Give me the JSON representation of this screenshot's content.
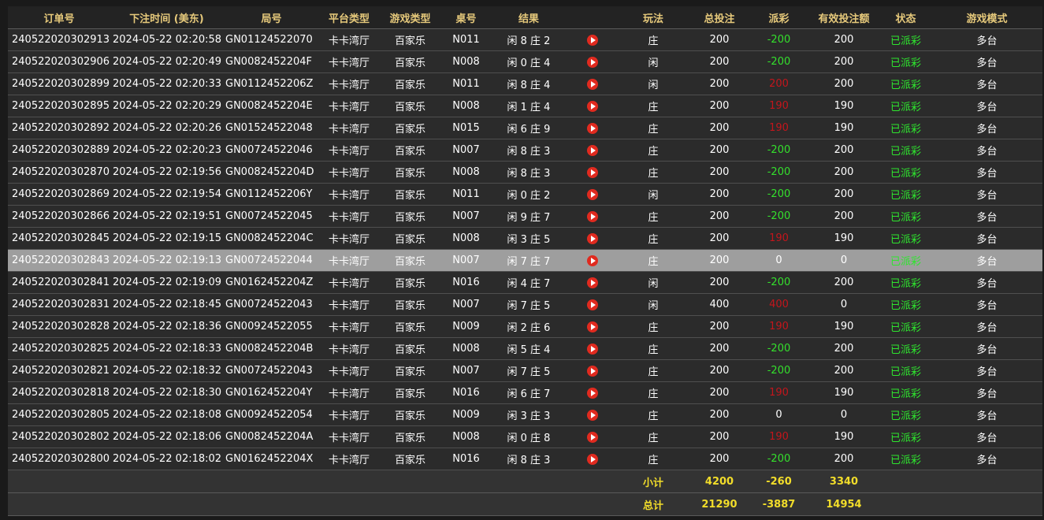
{
  "headers": [
    "订单号",
    "下注时间 (美东)",
    "局号",
    "平台类型",
    "游戏类型",
    "桌号",
    "结果",
    "",
    "玩法",
    "总投注",
    "派彩",
    "有效投注额",
    "状态",
    "游戏模式"
  ],
  "rows": [
    {
      "order": "240522020302913",
      "time": "2024-05-22 02:20:58",
      "round": "GN01124522070",
      "platform": "卡卡湾厅",
      "game": "百家乐",
      "table": "N011",
      "result": "闲 8 庄 2",
      "play": "庄",
      "bet": "200",
      "payout": "-200",
      "payout_type": "neg",
      "valid": "200",
      "status": "已派彩",
      "mode": "多台"
    },
    {
      "order": "240522020302906",
      "time": "2024-05-22 02:20:49",
      "round": "GN0082452204F",
      "platform": "卡卡湾厅",
      "game": "百家乐",
      "table": "N008",
      "result": "闲 0 庄 4",
      "play": "闲",
      "bet": "200",
      "payout": "-200",
      "payout_type": "neg",
      "valid": "200",
      "status": "已派彩",
      "mode": "多台"
    },
    {
      "order": "240522020302899",
      "time": "2024-05-22 02:20:33",
      "round": "GN0112452206Z",
      "platform": "卡卡湾厅",
      "game": "百家乐",
      "table": "N011",
      "result": "闲 8 庄 4",
      "play": "闲",
      "bet": "200",
      "payout": "200",
      "payout_type": "pos",
      "valid": "200",
      "status": "已派彩",
      "mode": "多台"
    },
    {
      "order": "240522020302895",
      "time": "2024-05-22 02:20:29",
      "round": "GN0082452204E",
      "platform": "卡卡湾厅",
      "game": "百家乐",
      "table": "N008",
      "result": "闲 1 庄 4",
      "play": "庄",
      "bet": "200",
      "payout": "190",
      "payout_type": "pos",
      "valid": "190",
      "status": "已派彩",
      "mode": "多台"
    },
    {
      "order": "240522020302892",
      "time": "2024-05-22 02:20:26",
      "round": "GN01524522048",
      "platform": "卡卡湾厅",
      "game": "百家乐",
      "table": "N015",
      "result": "闲 6 庄 9",
      "play": "庄",
      "bet": "200",
      "payout": "190",
      "payout_type": "pos",
      "valid": "190",
      "status": "已派彩",
      "mode": "多台"
    },
    {
      "order": "240522020302889",
      "time": "2024-05-22 02:20:23",
      "round": "GN00724522046",
      "platform": "卡卡湾厅",
      "game": "百家乐",
      "table": "N007",
      "result": "闲 8 庄 3",
      "play": "庄",
      "bet": "200",
      "payout": "-200",
      "payout_type": "neg",
      "valid": "200",
      "status": "已派彩",
      "mode": "多台"
    },
    {
      "order": "240522020302870",
      "time": "2024-05-22 02:19:56",
      "round": "GN0082452204D",
      "platform": "卡卡湾厅",
      "game": "百家乐",
      "table": "N008",
      "result": "闲 8 庄 3",
      "play": "庄",
      "bet": "200",
      "payout": "-200",
      "payout_type": "neg",
      "valid": "200",
      "status": "已派彩",
      "mode": "多台"
    },
    {
      "order": "240522020302869",
      "time": "2024-05-22 02:19:54",
      "round": "GN0112452206Y",
      "platform": "卡卡湾厅",
      "game": "百家乐",
      "table": "N011",
      "result": "闲 0 庄 2",
      "play": "闲",
      "bet": "200",
      "payout": "-200",
      "payout_type": "neg",
      "valid": "200",
      "status": "已派彩",
      "mode": "多台"
    },
    {
      "order": "240522020302866",
      "time": "2024-05-22 02:19:51",
      "round": "GN00724522045",
      "platform": "卡卡湾厅",
      "game": "百家乐",
      "table": "N007",
      "result": "闲 9 庄 7",
      "play": "庄",
      "bet": "200",
      "payout": "-200",
      "payout_type": "neg",
      "valid": "200",
      "status": "已派彩",
      "mode": "多台"
    },
    {
      "order": "240522020302845",
      "time": "2024-05-22 02:19:15",
      "round": "GN0082452204C",
      "platform": "卡卡湾厅",
      "game": "百家乐",
      "table": "N008",
      "result": "闲 3 庄 5",
      "play": "庄",
      "bet": "200",
      "payout": "190",
      "payout_type": "pos",
      "valid": "190",
      "status": "已派彩",
      "mode": "多台"
    },
    {
      "order": "240522020302843",
      "time": "2024-05-22 02:19:13",
      "round": "GN00724522044",
      "platform": "卡卡湾厅",
      "game": "百家乐",
      "table": "N007",
      "result": "闲 7 庄 7",
      "play": "庄",
      "bet": "200",
      "payout": "0",
      "payout_type": "zero",
      "valid": "0",
      "status": "已派彩",
      "mode": "多台",
      "highlight": true
    },
    {
      "order": "240522020302841",
      "time": "2024-05-22 02:19:09",
      "round": "GN0162452204Z",
      "platform": "卡卡湾厅",
      "game": "百家乐",
      "table": "N016",
      "result": "闲 4 庄 7",
      "play": "闲",
      "bet": "200",
      "payout": "-200",
      "payout_type": "neg",
      "valid": "200",
      "status": "已派彩",
      "mode": "多台"
    },
    {
      "order": "240522020302831",
      "time": "2024-05-22 02:18:45",
      "round": "GN00724522043",
      "platform": "卡卡湾厅",
      "game": "百家乐",
      "table": "N007",
      "result": "闲 7 庄 5",
      "play": "闲",
      "bet": "400",
      "payout": "400",
      "payout_type": "pos",
      "valid": "0",
      "status": "已派彩",
      "mode": "多台"
    },
    {
      "order": "240522020302828",
      "time": "2024-05-22 02:18:36",
      "round": "GN00924522055",
      "platform": "卡卡湾厅",
      "game": "百家乐",
      "table": "N009",
      "result": "闲 2 庄 6",
      "play": "庄",
      "bet": "200",
      "payout": "190",
      "payout_type": "pos",
      "valid": "190",
      "status": "已派彩",
      "mode": "多台"
    },
    {
      "order": "240522020302825",
      "time": "2024-05-22 02:18:33",
      "round": "GN0082452204B",
      "platform": "卡卡湾厅",
      "game": "百家乐",
      "table": "N008",
      "result": "闲 5 庄 4",
      "play": "庄",
      "bet": "200",
      "payout": "-200",
      "payout_type": "neg",
      "valid": "200",
      "status": "已派彩",
      "mode": "多台"
    },
    {
      "order": "240522020302821",
      "time": "2024-05-22 02:18:32",
      "round": "GN00724522043",
      "platform": "卡卡湾厅",
      "game": "百家乐",
      "table": "N007",
      "result": "闲 7 庄 5",
      "play": "庄",
      "bet": "200",
      "payout": "-200",
      "payout_type": "neg",
      "valid": "200",
      "status": "已派彩",
      "mode": "多台"
    },
    {
      "order": "240522020302818",
      "time": "2024-05-22 02:18:30",
      "round": "GN0162452204Y",
      "platform": "卡卡湾厅",
      "game": "百家乐",
      "table": "N016",
      "result": "闲 6 庄 7",
      "play": "庄",
      "bet": "200",
      "payout": "190",
      "payout_type": "pos",
      "valid": "190",
      "status": "已派彩",
      "mode": "多台"
    },
    {
      "order": "240522020302805",
      "time": "2024-05-22 02:18:08",
      "round": "GN00924522054",
      "platform": "卡卡湾厅",
      "game": "百家乐",
      "table": "N009",
      "result": "闲 3 庄 3",
      "play": "庄",
      "bet": "200",
      "payout": "0",
      "payout_type": "zero",
      "valid": "0",
      "status": "已派彩",
      "mode": "多台"
    },
    {
      "order": "240522020302802",
      "time": "2024-05-22 02:18:06",
      "round": "GN0082452204A",
      "platform": "卡卡湾厅",
      "game": "百家乐",
      "table": "N008",
      "result": "闲 0 庄 8",
      "play": "庄",
      "bet": "200",
      "payout": "190",
      "payout_type": "pos",
      "valid": "190",
      "status": "已派彩",
      "mode": "多台"
    },
    {
      "order": "240522020302800",
      "time": "2024-05-22 02:18:02",
      "round": "GN0162452204X",
      "platform": "卡卡湾厅",
      "game": "百家乐",
      "table": "N016",
      "result": "闲 8 庄 3",
      "play": "庄",
      "bet": "200",
      "payout": "-200",
      "payout_type": "neg",
      "valid": "200",
      "status": "已派彩",
      "mode": "多台"
    }
  ],
  "subtotal": {
    "label": "小计",
    "bet": "4200",
    "payout": "-260",
    "valid": "3340"
  },
  "total": {
    "label": "总计",
    "bet": "21290",
    "payout": "-3887",
    "valid": "14954"
  },
  "icons": {
    "replay": "play-circle-icon"
  },
  "colors": {
    "header_text": "#e6c97b",
    "negative_payout": "#34e02c",
    "positive_payout": "#c3161c",
    "status_paid": "#2ee62e",
    "totals_text": "#f2dd2a",
    "highlight_row": "#9e9e9e"
  }
}
